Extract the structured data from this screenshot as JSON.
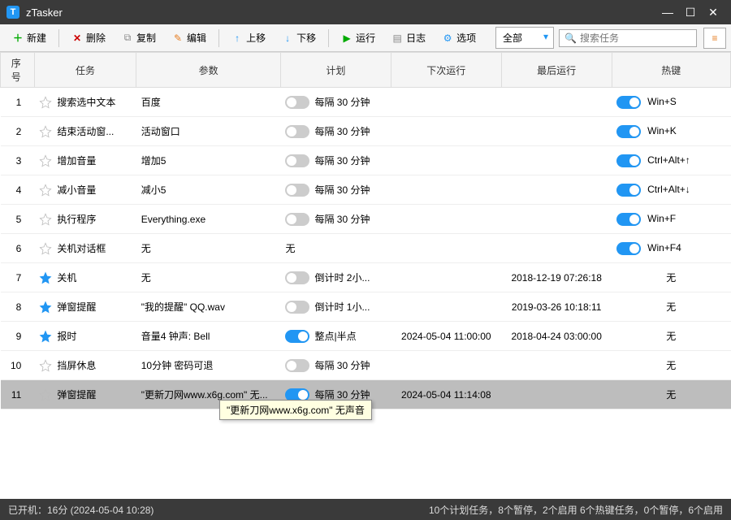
{
  "app": {
    "title": "zTasker"
  },
  "toolbar": {
    "new": "新建",
    "delete": "删除",
    "copy": "复制",
    "edit": "编辑",
    "up": "上移",
    "down": "下移",
    "run": "运行",
    "log": "日志",
    "options": "选项",
    "filter": "全部",
    "search_placeholder": "搜索任务"
  },
  "columns": {
    "num": "序号",
    "task": "任务",
    "param": "参数",
    "plan": "计划",
    "next": "下次运行",
    "last": "最后运行",
    "hotkey": "热键"
  },
  "rows": [
    {
      "num": 1,
      "star": false,
      "task": "搜索选中文本",
      "param": "百度",
      "enabled": false,
      "plan": "每隔 30 分钟",
      "next": "",
      "last": "",
      "hotkey": "Win+S",
      "has_hotkey": true
    },
    {
      "num": 2,
      "star": false,
      "task": "结束活动窗...",
      "param": "活动窗口",
      "enabled": false,
      "plan": "每隔 30 分钟",
      "next": "",
      "last": "",
      "hotkey": "Win+K",
      "has_hotkey": true
    },
    {
      "num": 3,
      "star": false,
      "task": "增加音量",
      "param": "增加5",
      "enabled": false,
      "plan": "每隔 30 分钟",
      "next": "",
      "last": "",
      "hotkey": "Ctrl+Alt+↑",
      "has_hotkey": true
    },
    {
      "num": 4,
      "star": false,
      "task": "减小音量",
      "param": "减小5",
      "enabled": false,
      "plan": "每隔 30 分钟",
      "next": "",
      "last": "",
      "hotkey": "Ctrl+Alt+↓",
      "has_hotkey": true
    },
    {
      "num": 5,
      "star": false,
      "task": "执行程序",
      "param": "Everything.exe",
      "enabled": false,
      "plan": "每隔 30 分钟",
      "next": "",
      "last": "",
      "hotkey": "Win+F",
      "has_hotkey": true
    },
    {
      "num": 6,
      "star": false,
      "task": "关机对话框",
      "param": "无",
      "enabled": false,
      "plan": "无",
      "next": "",
      "last": "",
      "hotkey": "Win+F4",
      "has_hotkey": true,
      "no_toggle": true
    },
    {
      "num": 7,
      "star": true,
      "task": "关机",
      "param": "无",
      "enabled": false,
      "plan": "倒计时 2小...",
      "next": "",
      "last": "2018-12-19 07:26:18",
      "hotkey": "无",
      "has_hotkey": false
    },
    {
      "num": 8,
      "star": true,
      "task": "弹窗提醒",
      "param": "\"我的提醒\" QQ.wav",
      "enabled": false,
      "plan": "倒计时 1小...",
      "next": "",
      "last": "2019-03-26 10:18:11",
      "hotkey": "无",
      "has_hotkey": false
    },
    {
      "num": 9,
      "star": true,
      "task": "报时",
      "param": "音量4 钟声: Bell",
      "enabled": true,
      "plan": "整点|半点",
      "next": "2024-05-04 11:00:00",
      "last": "2018-04-24 03:00:00",
      "hotkey": "无",
      "has_hotkey": false
    },
    {
      "num": 10,
      "star": false,
      "task": "挡屏休息",
      "param": "10分钟 密码可退",
      "enabled": false,
      "plan": "每隔 30 分钟",
      "next": "",
      "last": "",
      "hotkey": "无",
      "has_hotkey": false
    },
    {
      "num": 11,
      "star": false,
      "task": "弹窗提醒",
      "param": "\"更新刀网www.x6g.com\" 无...",
      "enabled": true,
      "plan": "每隔 30 分钟",
      "next": "2024-05-04 11:14:08",
      "last": "",
      "hotkey": "无",
      "has_hotkey": false,
      "selected": true
    }
  ],
  "tooltip": "\"更新刀网www.x6g.com\" 无声音",
  "status": {
    "left": "已开机：16分 (2024-05-04 10:28)",
    "right": "10个计划任务，8个暂停，2个启用    6个热键任务，0个暂停，6个启用"
  }
}
